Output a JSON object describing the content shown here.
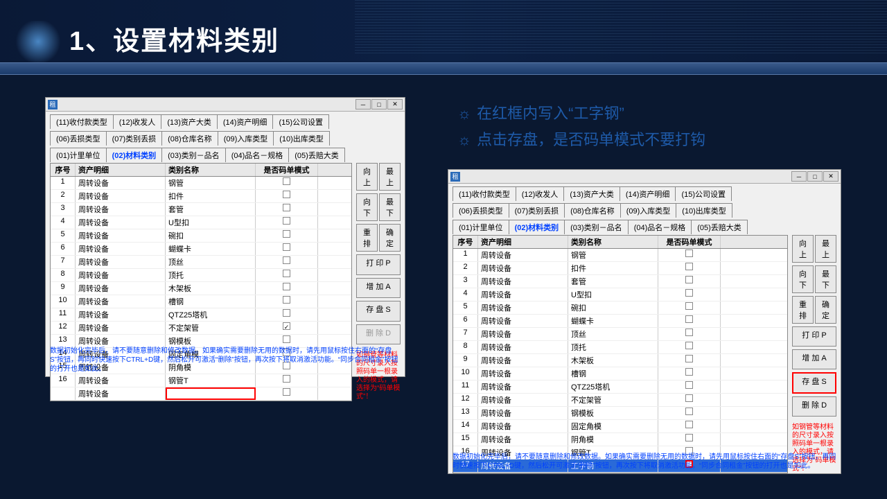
{
  "title": "1、设置材料类别",
  "instr": {
    "l1": "在红框内写入“工字钢”",
    "l2": "点击存盘，是否码单模式不要打钩"
  },
  "tabs": {
    "t11": "(11)收付款类型",
    "t12": "(12)收发人",
    "t13": "(13)资产大类",
    "t14": "(14)资产明细",
    "t15": "(15)公司设置",
    "t6": "(06)丢损类型",
    "t7": "(07)类别丢损",
    "t8": "(08)仓库名称",
    "t9": "(09)入库类型",
    "t10": "(10)出库类型",
    "t1": "(01)计里单位",
    "t2": "(02)材料类别",
    "t3": "(03)类别－品名",
    "t4": "(04)品名－规格",
    "t5": "(05)丢赔大类"
  },
  "headers": {
    "h1": "序号",
    "h2": "资产明细",
    "h3": "类别名称",
    "h4": "是否码单模式"
  },
  "btns": {
    "up": "向上",
    "top": "最上",
    "down": "向下",
    "bot": "最下",
    "rearr": "重排",
    "ok": "确定",
    "print": "打 印 P",
    "add": "增 加 A",
    "save": "存 盘 S",
    "del": "删 除 D"
  },
  "red": "如钢管等材料的尺寸录入按照码单一根录入的模式，请选择为“码单模式”！",
  "foot": "数据初始化完毕后，请不要随意删除和修改数据。如果确实需要删除无用的数据时，请先用鼠标按住右面的“存盘S”按钮，再同时快速按下CTRL+D键，然后松开可激活“删除”按钮，再次按下将取消激活功能。“同步合同租金”按钮的打开也是如此。",
  "rows1": [
    {
      "n": "1",
      "a": "周转设备",
      "b": "钢管",
      "c": false
    },
    {
      "n": "2",
      "a": "周转设备",
      "b": "扣件",
      "c": false
    },
    {
      "n": "3",
      "a": "周转设备",
      "b": "套管",
      "c": false
    },
    {
      "n": "4",
      "a": "周转设备",
      "b": "U型扣",
      "c": false
    },
    {
      "n": "5",
      "a": "周转设备",
      "b": "碗扣",
      "c": false
    },
    {
      "n": "6",
      "a": "周转设备",
      "b": "蝴蝶卡",
      "c": false
    },
    {
      "n": "7",
      "a": "周转设备",
      "b": "顶丝",
      "c": false
    },
    {
      "n": "8",
      "a": "周转设备",
      "b": "顶托",
      "c": false
    },
    {
      "n": "9",
      "a": "周转设备",
      "b": "木架板",
      "c": false
    },
    {
      "n": "10",
      "a": "周转设备",
      "b": "槽钢",
      "c": false
    },
    {
      "n": "11",
      "a": "周转设备",
      "b": "QTZ25塔机",
      "c": false
    },
    {
      "n": "12",
      "a": "周转设备",
      "b": "不定架管",
      "c": true
    },
    {
      "n": "13",
      "a": "周转设备",
      "b": "钢模板",
      "c": false
    },
    {
      "n": "14",
      "a": "周转设备",
      "b": "固定角模",
      "c": false
    },
    {
      "n": "15",
      "a": "周转设备",
      "b": "阴角模",
      "c": false
    },
    {
      "n": "16",
      "a": "周转设备",
      "b": "钢管T",
      "c": false
    },
    {
      "n": "",
      "a": "周转设备",
      "b": "",
      "c": false,
      "red": true
    }
  ],
  "rows2": [
    {
      "n": "1",
      "a": "周转设备",
      "b": "钢管",
      "c": false
    },
    {
      "n": "2",
      "a": "周转设备",
      "b": "扣件",
      "c": false
    },
    {
      "n": "3",
      "a": "周转设备",
      "b": "套管",
      "c": false
    },
    {
      "n": "4",
      "a": "周转设备",
      "b": "U型扣",
      "c": false
    },
    {
      "n": "5",
      "a": "周转设备",
      "b": "碗扣",
      "c": false
    },
    {
      "n": "6",
      "a": "周转设备",
      "b": "蝴蝶卡",
      "c": false
    },
    {
      "n": "7",
      "a": "周转设备",
      "b": "顶丝",
      "c": false
    },
    {
      "n": "8",
      "a": "周转设备",
      "b": "顶托",
      "c": false
    },
    {
      "n": "9",
      "a": "周转设备",
      "b": "木架板",
      "c": false
    },
    {
      "n": "10",
      "a": "周转设备",
      "b": "槽钢",
      "c": false
    },
    {
      "n": "11",
      "a": "周转设备",
      "b": "QTZ25塔机",
      "c": false
    },
    {
      "n": "12",
      "a": "周转设备",
      "b": "不定架管",
      "c": false
    },
    {
      "n": "13",
      "a": "周转设备",
      "b": "钢模板",
      "c": false
    },
    {
      "n": "14",
      "a": "周转设备",
      "b": "固定角模",
      "c": false
    },
    {
      "n": "15",
      "a": "周转设备",
      "b": "阴角模",
      "c": false
    },
    {
      "n": "16",
      "a": "周转设备",
      "b": "钢管T",
      "c": false
    },
    {
      "n": "17",
      "a": "周转设备",
      "b": "工字钢",
      "c": false,
      "sel": true,
      "redck": true
    }
  ]
}
